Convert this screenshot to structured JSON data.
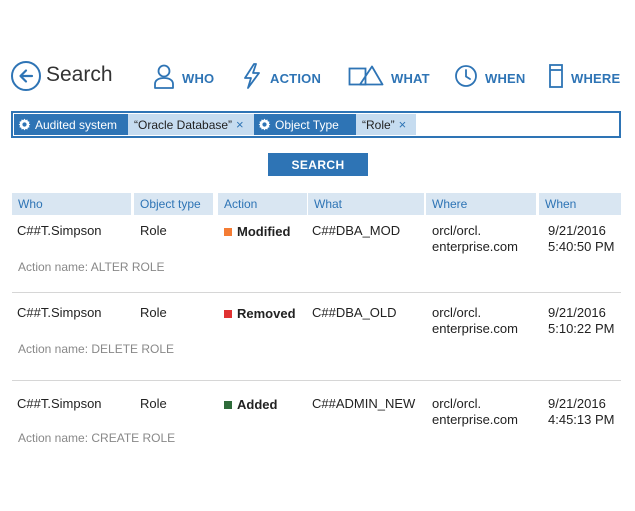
{
  "header": {
    "title": "Search"
  },
  "nav": [
    {
      "key": "who",
      "label": "WHO",
      "icon": "user-icon"
    },
    {
      "key": "action",
      "label": "ACTION",
      "icon": "lightning-icon"
    },
    {
      "key": "what",
      "label": "WHAT",
      "icon": "shapes-icon"
    },
    {
      "key": "when",
      "label": "WHEN",
      "icon": "clock-icon"
    },
    {
      "key": "where",
      "label": "WHERE",
      "icon": "server-icon"
    }
  ],
  "filters": [
    {
      "key": "Audited system",
      "value": "“Oracle Database”"
    },
    {
      "key": "Object Type",
      "value": "“Role”"
    }
  ],
  "search_button": "SEARCH",
  "columns": [
    "Who",
    "Object type",
    "Action",
    "What",
    "Where",
    "When"
  ],
  "rows": [
    {
      "who": "C##T.Simpson",
      "object_type": "Role",
      "action": "Modified",
      "action_color": "#f47c34",
      "what": "C##DBA_MOD",
      "where1": "orcl/orcl.",
      "where2": "enterprise.com",
      "when1": "9/21/2016",
      "when2": "5:40:50 PM",
      "detail": "Action name: ALTER ROLE"
    },
    {
      "who": "C##T.Simpson",
      "object_type": "Role",
      "action": "Removed",
      "action_color": "#e03232",
      "what": "C##DBA_OLD",
      "where1": "orcl/orcl.",
      "where2": "enterprise.com",
      "when1": "9/21/2016",
      "when2": "5:10:22 PM",
      "detail": "Action name: DELETE ROLE"
    },
    {
      "who": "C##T.Simpson",
      "object_type": "Role",
      "action": "Added",
      "action_color": "#2e6b3a",
      "what": "C##ADMIN_NEW",
      "where1": "orcl/orcl.",
      "where2": "enterprise.com",
      "when1": "9/21/2016",
      "when2": "4:45:13 PM",
      "detail": "Action name: CREATE ROLE"
    }
  ],
  "colors": {
    "accent": "#2e74b5",
    "header_bg": "#d9e6f2",
    "chip_value_bg": "#c6dcf0"
  }
}
